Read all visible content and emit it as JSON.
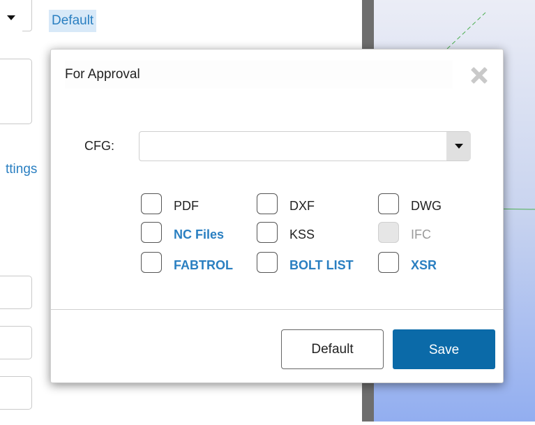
{
  "background": {
    "default_link": "Default",
    "settings_link": "ttings"
  },
  "dialog": {
    "title": "For Approval",
    "cfg": {
      "label": "CFG:",
      "value": ""
    },
    "outputs": [
      {
        "label": "PDF",
        "checked": false,
        "enabled": true
      },
      {
        "label": "DXF",
        "checked": false,
        "enabled": true
      },
      {
        "label": "DWG",
        "checked": false,
        "enabled": true
      },
      {
        "label": "NC Files",
        "checked": false,
        "enabled": true
      },
      {
        "label": "KSS",
        "checked": false,
        "enabled": true
      },
      {
        "label": "IFC",
        "checked": false,
        "enabled": false
      },
      {
        "label": "FABTROL",
        "checked": false,
        "enabled": true
      },
      {
        "label": "BOLT LIST",
        "checked": false,
        "enabled": true
      },
      {
        "label": "XSR",
        "checked": false,
        "enabled": true
      }
    ],
    "buttons": {
      "default_label": "Default",
      "save_label": "Save"
    }
  },
  "colors": {
    "link": "#2a7fc1",
    "primary_button": "#0b6aa8",
    "viewport_gradient_top": "#ebedf6",
    "viewport_gradient_bottom": "#92aef0",
    "panel_divider": "#6e6e6e"
  }
}
